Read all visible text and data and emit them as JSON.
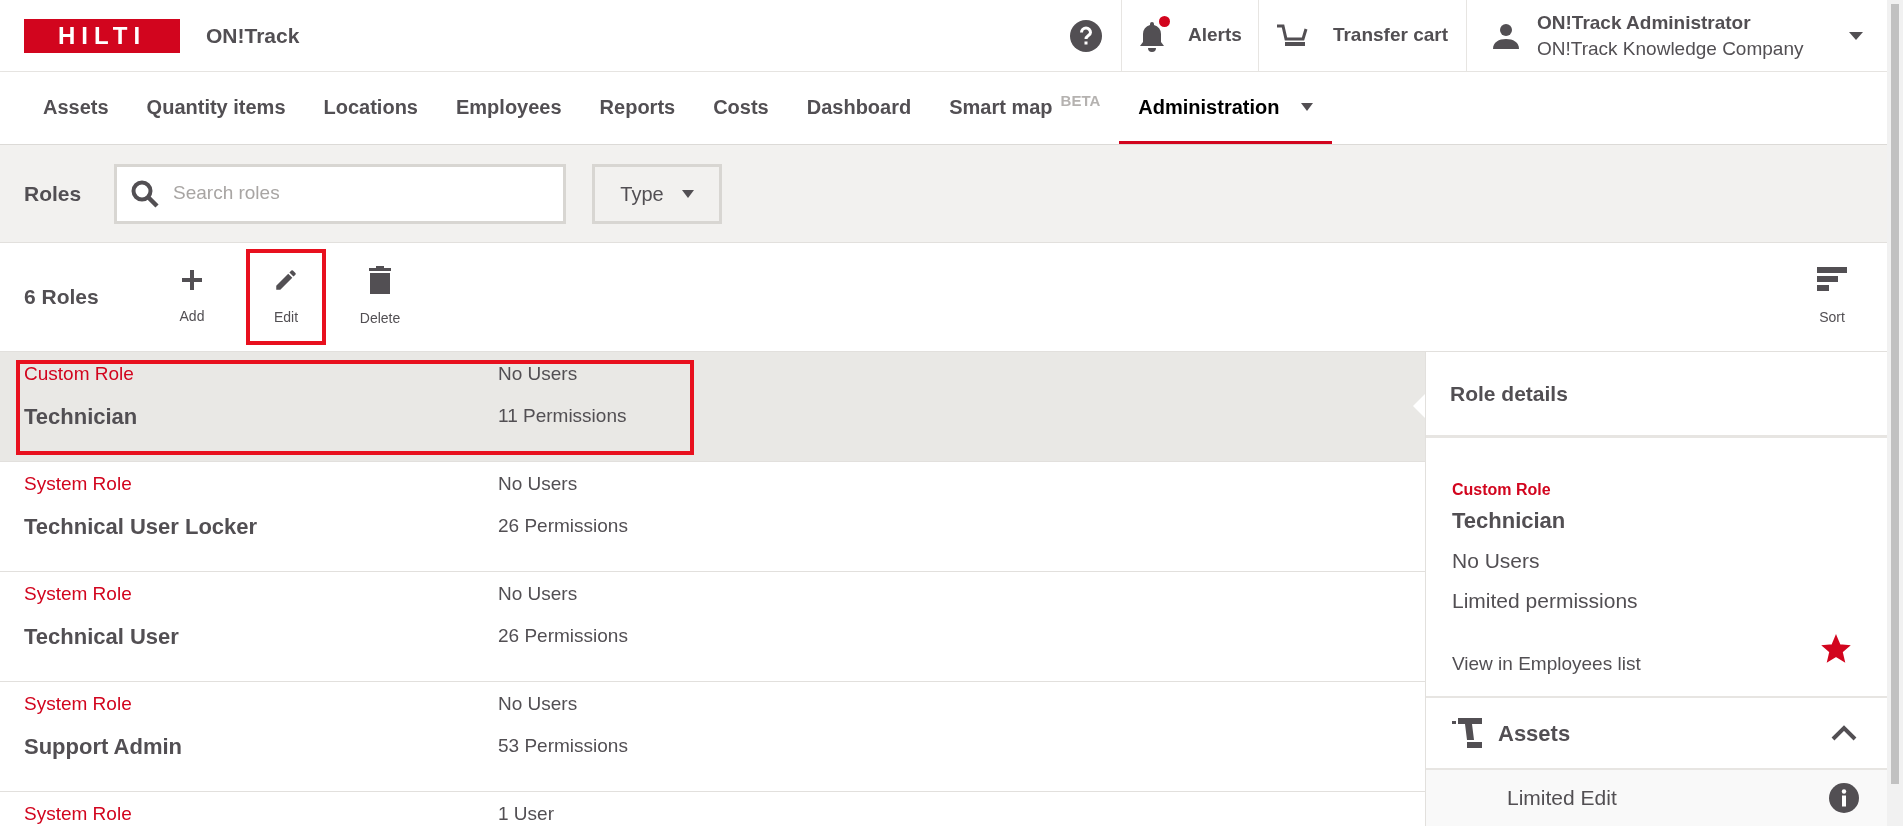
{
  "header": {
    "logo": "HILTI",
    "app_name": "ON!Track",
    "alerts": {
      "label": "Alerts",
      "unread": true
    },
    "transfer_cart": "Transfer cart",
    "user": {
      "name": "ON!Track Administrator",
      "company": "ON!Track Knowledge Company"
    }
  },
  "nav": [
    {
      "label": "Assets",
      "selected": false
    },
    {
      "label": "Quantity items",
      "selected": false
    },
    {
      "label": "Locations",
      "selected": false
    },
    {
      "label": "Employees",
      "selected": false
    },
    {
      "label": "Reports",
      "selected": false
    },
    {
      "label": "Costs",
      "selected": false
    },
    {
      "label": "Dashboard",
      "selected": false
    },
    {
      "label": "Smart map",
      "badge": "BETA",
      "selected": false
    },
    {
      "label": "Administration",
      "dropdown": true,
      "selected": true
    }
  ],
  "filter_bar": {
    "title": "Roles",
    "search_placeholder": "Search roles",
    "type_filter": "Type"
  },
  "toolbar": {
    "count": "6 Roles",
    "actions": [
      {
        "kind": "add",
        "label": "Add",
        "highlighted": false
      },
      {
        "kind": "edit",
        "label": "Edit",
        "highlighted": true
      },
      {
        "kind": "delete",
        "label": "Delete",
        "highlighted": false
      }
    ],
    "sort": "Sort"
  },
  "roles": [
    {
      "type": "Custom Role",
      "name": "Technician",
      "users": "No Users",
      "permissions": "11 Permissions",
      "selected": true,
      "highlighted": true
    },
    {
      "type": "System Role",
      "name": "Technical User Locker",
      "users": "No Users",
      "permissions": "26 Permissions",
      "selected": false,
      "highlighted": false
    },
    {
      "type": "System Role",
      "name": "Technical User",
      "users": "No Users",
      "permissions": "26 Permissions",
      "selected": false,
      "highlighted": false
    },
    {
      "type": "System Role",
      "name": "Support Admin",
      "users": "No Users",
      "permissions": "53 Permissions",
      "selected": false,
      "highlighted": false
    },
    {
      "type": "System Role",
      "users": "1 User",
      "selected": false,
      "highlighted": false
    }
  ],
  "role_details": {
    "title": "Role details",
    "type": "Custom Role",
    "name": "Technician",
    "users": "No Users",
    "permissions": "Limited permissions",
    "link": "View in Employees list",
    "favorite": true,
    "sections": [
      {
        "title": "Assets",
        "expanded": true,
        "items": [
          "Limited Edit"
        ]
      }
    ]
  }
}
